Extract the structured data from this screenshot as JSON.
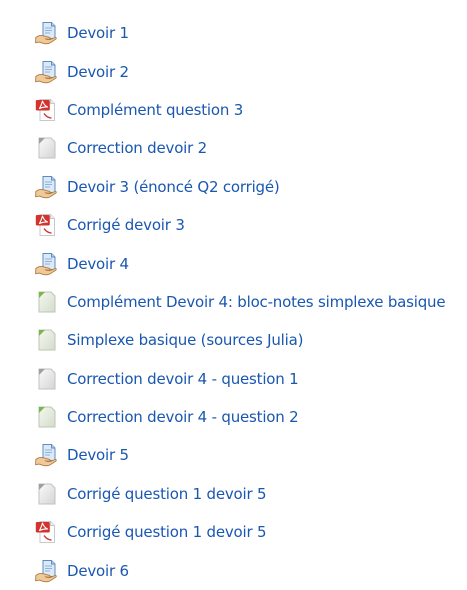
{
  "activities": [
    {
      "icon": "assignment-icon",
      "label": "Devoir 1"
    },
    {
      "icon": "assignment-icon",
      "label": "Devoir 2"
    },
    {
      "icon": "pdf-icon",
      "label": "Complément question 3"
    },
    {
      "icon": "file-icon",
      "label": "Correction devoir 2"
    },
    {
      "icon": "assignment-icon",
      "label": "Devoir 3 (énoncé Q2 corrigé)"
    },
    {
      "icon": "pdf-icon",
      "label": "Corrigé devoir 3"
    },
    {
      "icon": "assignment-icon",
      "label": "Devoir 4"
    },
    {
      "icon": "document-icon",
      "label": "Complément Devoir 4: bloc-notes simplexe basique"
    },
    {
      "icon": "document-icon",
      "label": "Simplexe basique (sources Julia)"
    },
    {
      "icon": "file-icon",
      "label": "Correction devoir 4 - question 1"
    },
    {
      "icon": "document-icon",
      "label": "Correction devoir 4 - question 2"
    },
    {
      "icon": "assignment-icon",
      "label": "Devoir 5"
    },
    {
      "icon": "file-icon",
      "label": "Corrigé question 1 devoir 5"
    },
    {
      "icon": "pdf-icon",
      "label": "Corrigé question 1 devoir 5"
    },
    {
      "icon": "assignment-icon",
      "label": "Devoir 6"
    }
  ],
  "colors": {
    "link": "#1a57b1"
  }
}
